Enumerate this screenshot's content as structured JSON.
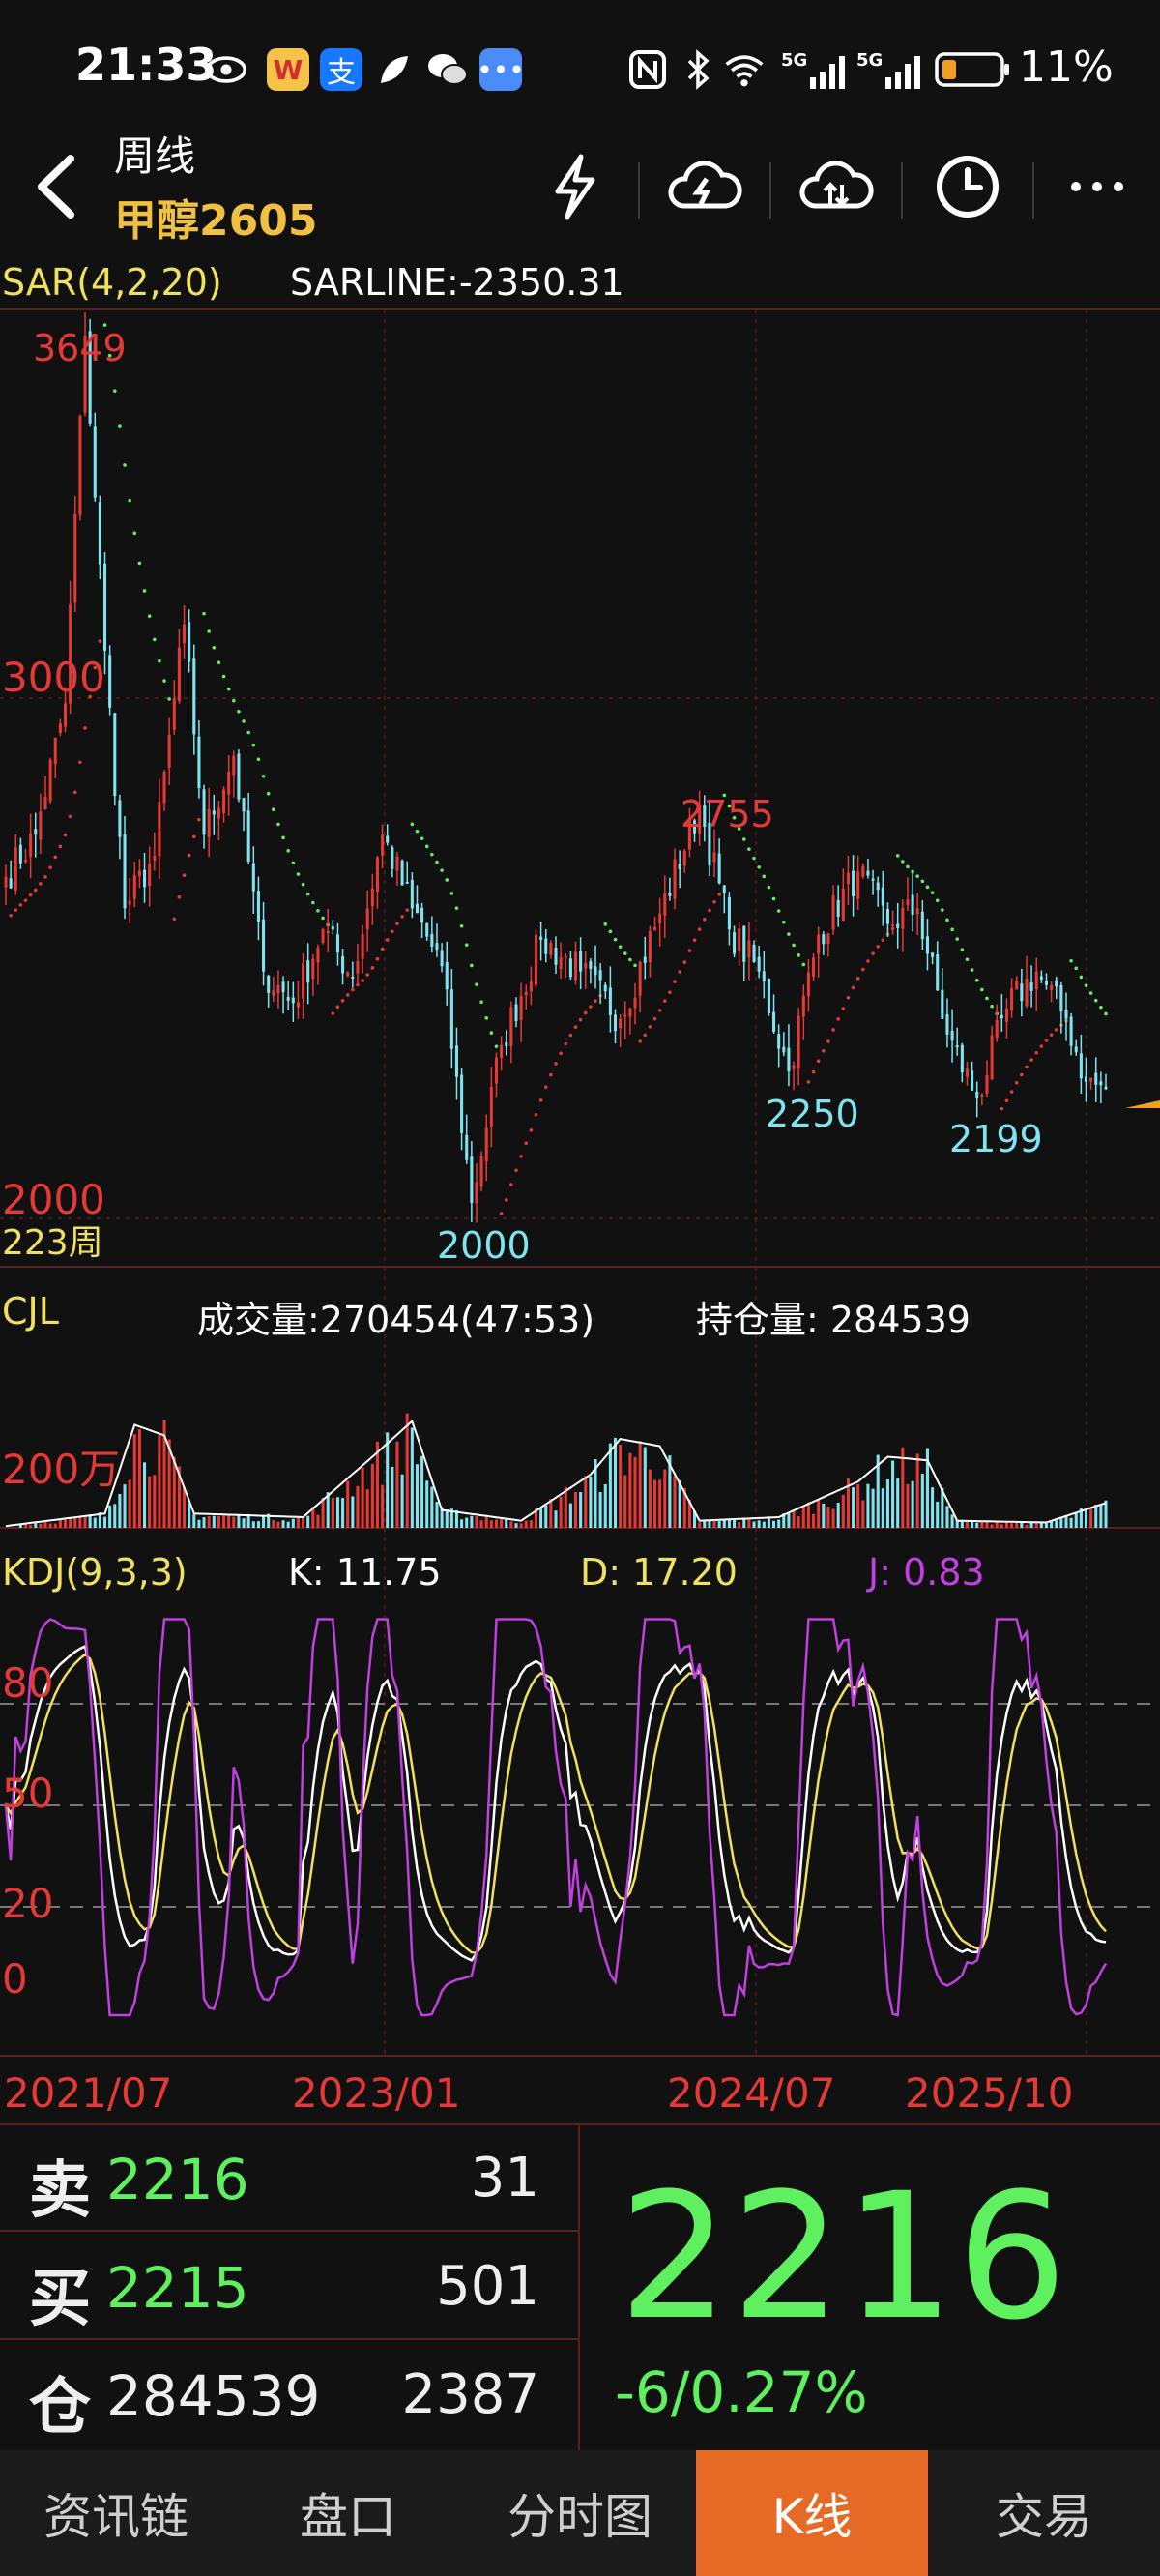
{
  "status_bar": {
    "time": "21:33",
    "battery": "11%",
    "network": "5G"
  },
  "nav": {
    "period": "周线",
    "symbol": "甲醇2605"
  },
  "main_chart": {
    "indicator": "SAR(4,2,20)",
    "sarline": "SARLINE:-2350.31",
    "y_labels": [
      "3000",
      "2000"
    ],
    "bars_label": "223周",
    "annotations": [
      {
        "text": "3649",
        "color": "#e53935"
      },
      {
        "text": "2755",
        "color": "#e53935"
      },
      {
        "text": "2000",
        "color": "#7fe3f0"
      },
      {
        "text": "2250",
        "color": "#7fe3f0"
      },
      {
        "text": "2199",
        "color": "#7fe3f0"
      }
    ]
  },
  "volume_panel": {
    "name": "CJL",
    "volume": "成交量:270454(47:53)",
    "open_interest": "持仓量: 284539",
    "y_label": "200万"
  },
  "kdj_panel": {
    "name": "KDJ(9,3,3)",
    "k": "K: 11.75",
    "d": "D: 17.20",
    "j": "J: 0.83",
    "y_labels": [
      "80",
      "50",
      "20",
      "0"
    ]
  },
  "dates": [
    "2021/07",
    "2023/01",
    "2024/07",
    "2025/10"
  ],
  "quote": {
    "sell_key": "卖",
    "sell_price": "2216",
    "sell_qty": "31",
    "buy_key": "买",
    "buy_price": "2215",
    "buy_qty": "501",
    "oi_key": "仓",
    "oi_value": "284539",
    "oi_change": "2387",
    "last": "2216",
    "change": "-6/0.27%"
  },
  "tabs": [
    "资讯链",
    "盘口",
    "分时图",
    "K线",
    "交易"
  ],
  "active_tab": "K线",
  "colors": {
    "up": "#e53935",
    "down": "#7fe3f0",
    "accent": "#f0c040",
    "k_line": "#ffffff",
    "d_line": "#f0e060",
    "j_line": "#c040e0",
    "price": "#5ef05e"
  },
  "chart_data": {
    "type": "candlestick",
    "title": "甲醇2605 周线",
    "ylim": [
      1990,
      3660
    ],
    "x_ticks": [
      "2021/07",
      "2023/01",
      "2024/07",
      "2025/10"
    ],
    "bars": 223,
    "anchors": [
      {
        "i": 0,
        "v": 2620
      },
      {
        "i": 6,
        "v": 2700
      },
      {
        "i": 12,
        "v": 2950
      },
      {
        "i": 16,
        "v": 3649
      },
      {
        "i": 20,
        "v": 3050
      },
      {
        "i": 24,
        "v": 2560
      },
      {
        "i": 30,
        "v": 2660
      },
      {
        "i": 36,
        "v": 3100
      },
      {
        "i": 40,
        "v": 2700
      },
      {
        "i": 46,
        "v": 2850
      },
      {
        "i": 52,
        "v": 2440
      },
      {
        "i": 58,
        "v": 2380
      },
      {
        "i": 64,
        "v": 2520
      },
      {
        "i": 70,
        "v": 2430
      },
      {
        "i": 76,
        "v": 2700
      },
      {
        "i": 82,
        "v": 2560
      },
      {
        "i": 88,
        "v": 2450
      },
      {
        "i": 94,
        "v": 2000
      },
      {
        "i": 100,
        "v": 2300
      },
      {
        "i": 108,
        "v": 2500
      },
      {
        "i": 116,
        "v": 2440
      },
      {
        "i": 124,
        "v": 2350
      },
      {
        "i": 132,
        "v": 2550
      },
      {
        "i": 140,
        "v": 2755
      },
      {
        "i": 146,
        "v": 2520
      },
      {
        "i": 152,
        "v": 2440
      },
      {
        "i": 158,
        "v": 2250
      },
      {
        "i": 164,
        "v": 2510
      },
      {
        "i": 172,
        "v": 2630
      },
      {
        "i": 178,
        "v": 2530
      },
      {
        "i": 184,
        "v": 2560
      },
      {
        "i": 190,
        "v": 2320
      },
      {
        "i": 196,
        "v": 2199
      },
      {
        "i": 202,
        "v": 2370
      },
      {
        "i": 208,
        "v": 2440
      },
      {
        "i": 214,
        "v": 2350
      },
      {
        "i": 218,
        "v": 2230
      },
      {
        "i": 222,
        "v": 2216
      }
    ],
    "volume_anchors_wan": [
      {
        "i": 0,
        "v": 5
      },
      {
        "i": 20,
        "v": 40
      },
      {
        "i": 26,
        "v": 290
      },
      {
        "i": 32,
        "v": 260
      },
      {
        "i": 38,
        "v": 40
      },
      {
        "i": 60,
        "v": 30
      },
      {
        "i": 74,
        "v": 200
      },
      {
        "i": 82,
        "v": 300
      },
      {
        "i": 88,
        "v": 50
      },
      {
        "i": 104,
        "v": 20
      },
      {
        "i": 118,
        "v": 150
      },
      {
        "i": 124,
        "v": 250
      },
      {
        "i": 132,
        "v": 230
      },
      {
        "i": 140,
        "v": 20
      },
      {
        "i": 156,
        "v": 30
      },
      {
        "i": 172,
        "v": 130
      },
      {
        "i": 178,
        "v": 200
      },
      {
        "i": 186,
        "v": 190
      },
      {
        "i": 192,
        "v": 20
      },
      {
        "i": 210,
        "v": 15
      },
      {
        "i": 222,
        "v": 70
      }
    ],
    "kdj_ylim": [
      -12,
      105
    ],
    "kdj_last": {
      "k": 11.75,
      "d": 17.2,
      "j": 0.83
    }
  }
}
